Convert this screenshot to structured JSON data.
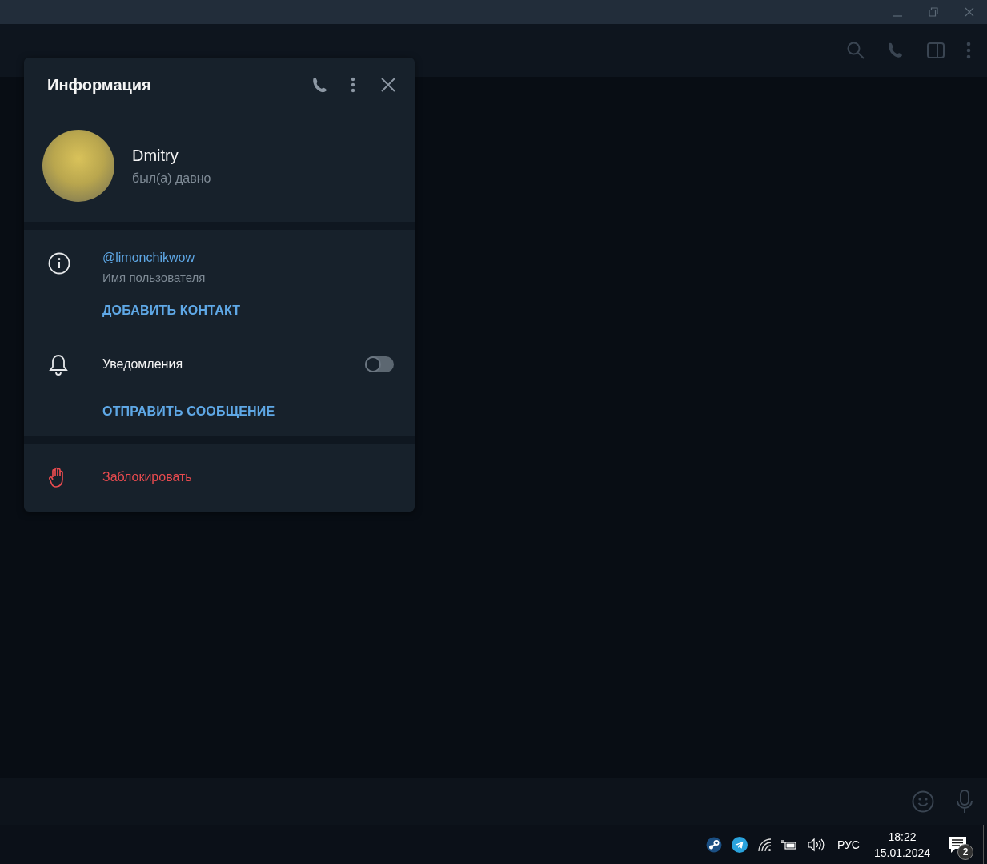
{
  "info_panel": {
    "title": "Информация",
    "profile": {
      "name": "Dmitry",
      "status": "был(а) давно"
    },
    "username": {
      "value": "@limonchikwow",
      "label": "Имя пользователя"
    },
    "add_contact": "ДОБАВИТЬ КОНТАКТ",
    "notifications": {
      "label": "Уведомления",
      "on": false
    },
    "send_message": "ОТПРАВИТЬ СООБЩЕНИЕ",
    "block": "Заблокировать"
  },
  "taskbar": {
    "language": "РУС",
    "time": "18:22",
    "date": "15.01.2024",
    "notification_count": "2"
  }
}
